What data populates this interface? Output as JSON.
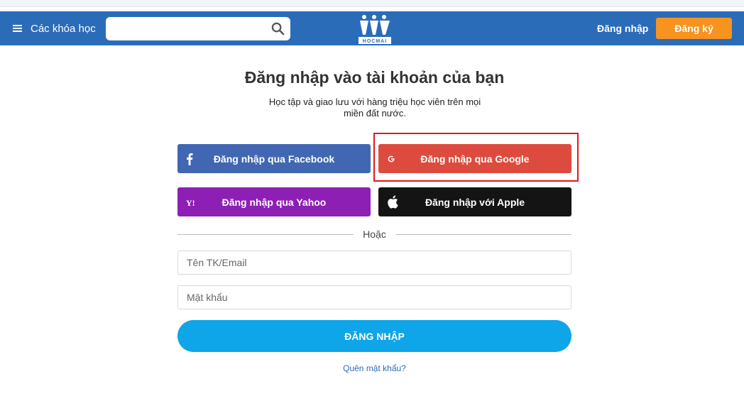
{
  "header": {
    "menu_label": "Các khóa học",
    "search_value": "",
    "logo_text": "HOCMAI",
    "login_label": "Đăng nhập",
    "register_label": "Đăng ký"
  },
  "main": {
    "title": "Đăng nhập vào tài khoản của bạn",
    "subtitle": "Học tập và giao lưu với hàng triệu học viên trên mọi miền đất nước.",
    "facebook_label": "Đăng nhập qua Facebook",
    "google_label": "Đăng nhập qua Google",
    "yahoo_label": "Đăng nhập qua Yahoo",
    "apple_label": "Đăng nhập với Apple",
    "or_text": "Hoặc",
    "username_placeholder": "Tên TK/Email",
    "password_placeholder": "Mật khẩu",
    "submit_label": "ĐĂNG NHẬP",
    "forgot_label": "Quên mật khẩu?"
  },
  "colors": {
    "navbar": "#2b6cb8",
    "register": "#f7931e",
    "facebook": "#4267b2",
    "google": "#dd4b3e",
    "yahoo": "#8e1fb5",
    "apple": "#141414",
    "submit": "#0ea5e9",
    "highlight": "#e0181b"
  },
  "icons": [
    "menu-icon",
    "search-icon",
    "facebook-icon",
    "google-icon",
    "yahoo-icon",
    "apple-icon"
  ]
}
